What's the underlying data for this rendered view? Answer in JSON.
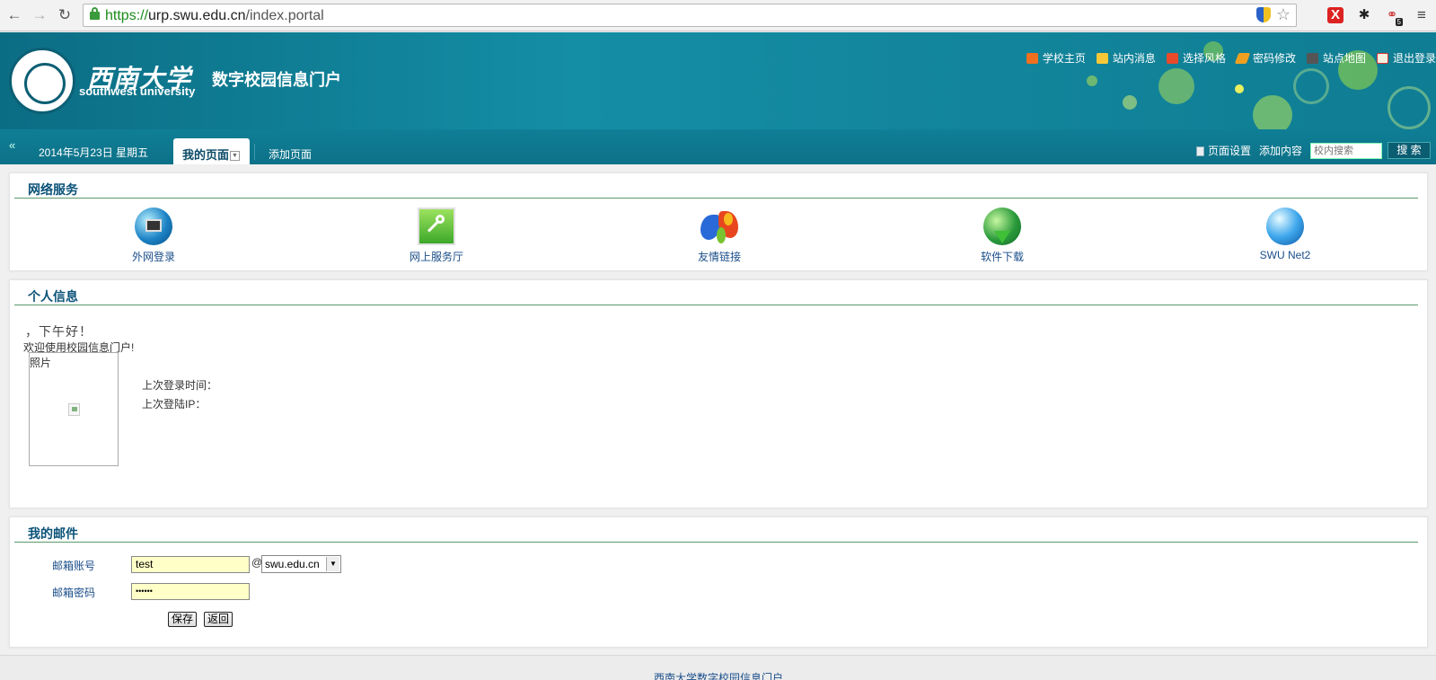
{
  "browser": {
    "url_scheme": "https://",
    "url_host": "urp.swu.edu.cn",
    "url_path": "/index.portal",
    "extension_badge": "5"
  },
  "header": {
    "logo_cn": "西南大学",
    "logo_en": "southwest university",
    "portal_title": "数字校园信息门户",
    "top_links": [
      "学校主页",
      "站内消息",
      "选择风格",
      "密码修改",
      "站点地图",
      "退出登录"
    ]
  },
  "tabbar": {
    "date": "2014年5月23日 星期五",
    "active_tab": "我的页面",
    "add_tab": "添加页面",
    "page_settings": "页面设置",
    "add_content": "添加内容",
    "search_placeholder": "校内搜索",
    "search_button": "搜 索"
  },
  "network_services": {
    "title": "网络服务",
    "items": [
      "外网登录",
      "网上服务厅",
      "友情链接",
      "软件下载",
      "SWU Net2"
    ]
  },
  "personal_info": {
    "title": "个人信息",
    "greeting": "，下午好！",
    "welcome": "欢迎使用校园信息门户!",
    "photo_label": "照片",
    "last_login_time_label": "上次登录时间：",
    "last_login_ip_label": "上次登陆IP："
  },
  "mail": {
    "title": "我的邮件",
    "account_label": "邮箱账号",
    "account_value": "test",
    "at_sign": "@",
    "domain_value": "swu.edu.cn",
    "password_label": "邮箱密码",
    "password_value": "••••••",
    "save_button": "保存",
    "back_button": "返回"
  },
  "footer": {
    "text": "西南大学数字校园信息门户"
  }
}
